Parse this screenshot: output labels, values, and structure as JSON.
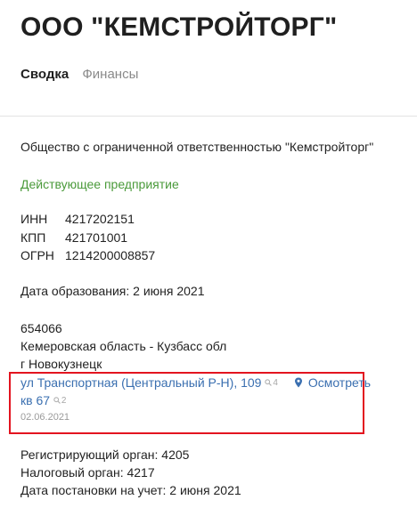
{
  "company": {
    "title": "ООО \"КЕМСТРОЙТОРГ\"",
    "full_name": "Общество с ограниченной ответственностью \"Кемстройторг\"",
    "status": "Действующее предприятие"
  },
  "tabs": [
    {
      "label": "Сводка",
      "active": true
    },
    {
      "label": "Финансы",
      "active": false
    }
  ],
  "requisites": [
    {
      "label": "ИНН",
      "value": "4217202151"
    },
    {
      "label": "КПП",
      "value": "421701001"
    },
    {
      "label": "ОГРН",
      "value": "1214200008857"
    }
  ],
  "founded": "Дата образования: 2 июня 2021",
  "address": {
    "postcode": "654066",
    "region": "Кемеровская область - Кузбасс обл",
    "city": "г Новокузнецк",
    "street_link": "ул Транспортная (Центральный Р-Н), 109",
    "street_count": "4",
    "view_link": "Осмотреть",
    "flat_link": "кв 67",
    "flat_count": "2",
    "date": "02.06.2021"
  },
  "registration": {
    "reg_authority": "Регистрирующий орган: 4205",
    "tax_authority": "Налоговый орган: 4217",
    "tax_date": "Дата постановки на учет: 2 июня 2021"
  },
  "colors": {
    "status_green": "#4a9a3a",
    "link_blue": "#3a6fb0",
    "highlight_red": "#e3141f"
  },
  "icons": [
    "search-icon",
    "map-pin-icon"
  ]
}
